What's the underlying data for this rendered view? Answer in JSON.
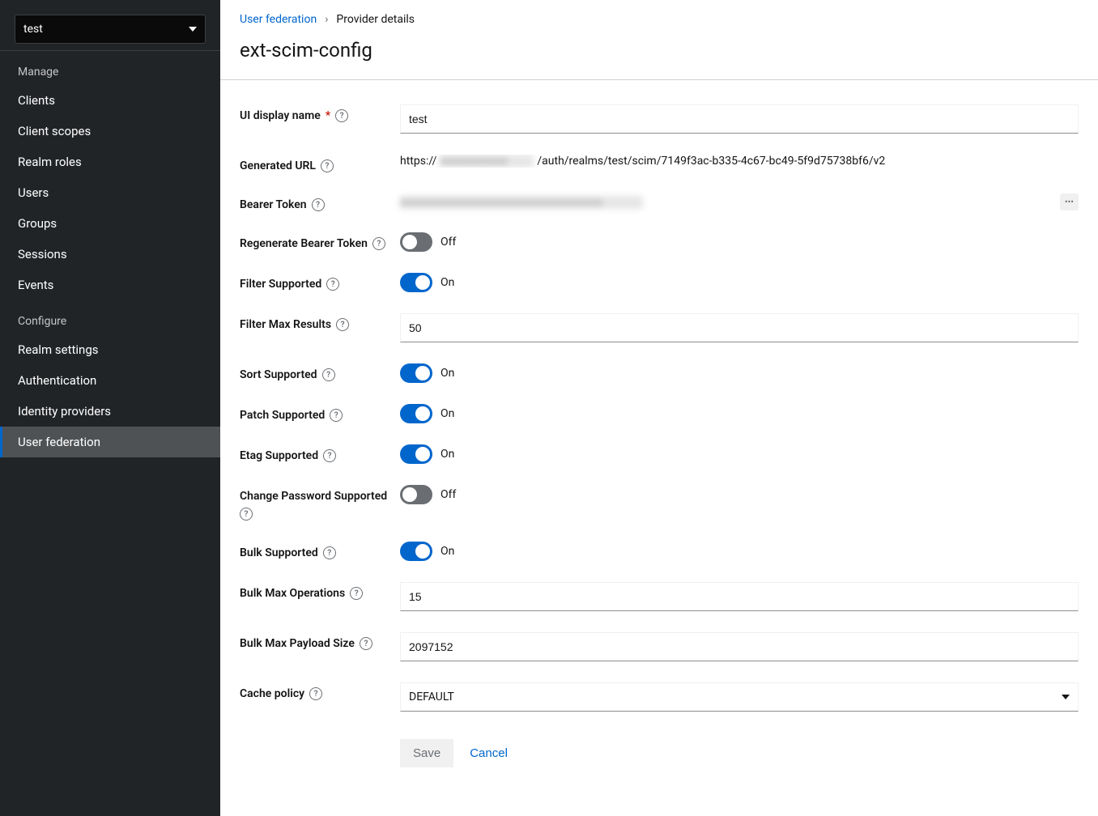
{
  "realm_selector": {
    "value": "test"
  },
  "sidebar": {
    "manage_title": "Manage",
    "configure_title": "Configure",
    "manage_items": [
      "Clients",
      "Client scopes",
      "Realm roles",
      "Users",
      "Groups",
      "Sessions",
      "Events"
    ],
    "configure_items": [
      "Realm settings",
      "Authentication",
      "Identity providers",
      "User federation"
    ]
  },
  "breadcrumb": {
    "link": "User federation",
    "current": "Provider details"
  },
  "page_title": "ext-scim-config",
  "form": {
    "ui_display_name": {
      "label": "UI display name",
      "value": "test"
    },
    "generated_url": {
      "label": "Generated URL",
      "prefix": "https://",
      "suffix": "/auth/realms/test/scim/7149f3ac-b335-4c67-bc49-5f9d75738bf6/v2"
    },
    "bearer_token": {
      "label": "Bearer Token",
      "value": ""
    },
    "regenerate_token": {
      "label": "Regenerate Bearer Token",
      "on": false,
      "state": "Off"
    },
    "filter_supported": {
      "label": "Filter Supported",
      "on": true,
      "state": "On"
    },
    "filter_max_results": {
      "label": "Filter Max Results",
      "value": "50"
    },
    "sort_supported": {
      "label": "Sort Supported",
      "on": true,
      "state": "On"
    },
    "patch_supported": {
      "label": "Patch Supported",
      "on": true,
      "state": "On"
    },
    "etag_supported": {
      "label": "Etag Supported",
      "on": true,
      "state": "On"
    },
    "change_password": {
      "label": "Change Password Supported",
      "on": false,
      "state": "Off"
    },
    "bulk_supported": {
      "label": "Bulk Supported",
      "on": true,
      "state": "On"
    },
    "bulk_max_ops": {
      "label": "Bulk Max Operations",
      "value": "15"
    },
    "bulk_max_payload": {
      "label": "Bulk Max Payload Size",
      "value": "2097152"
    },
    "cache_policy": {
      "label": "Cache policy",
      "value": "DEFAULT"
    }
  },
  "buttons": {
    "save": "Save",
    "cancel": "Cancel"
  }
}
